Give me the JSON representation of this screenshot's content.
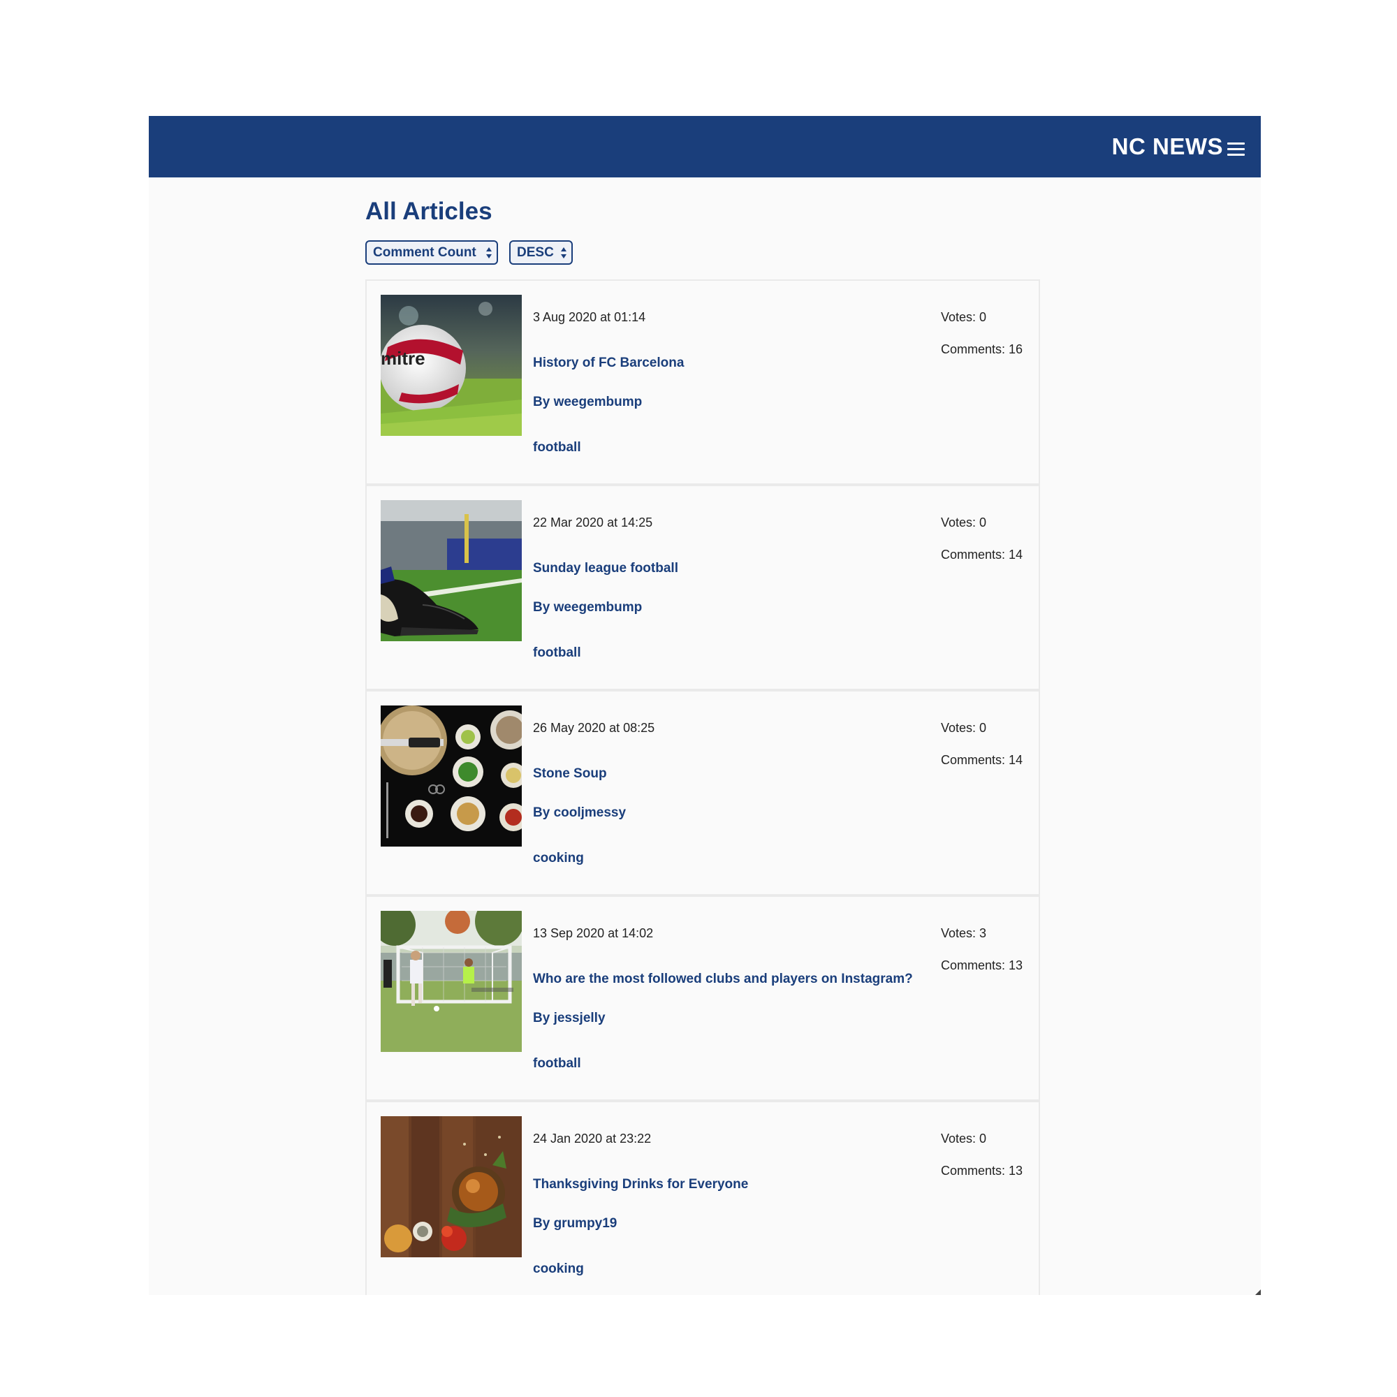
{
  "header": {
    "brand": "NC NEWS",
    "menu_icon": "hamburger-menu-icon"
  },
  "page": {
    "title": "All Articles"
  },
  "controls": {
    "sort_by": {
      "selected": "Comment Count"
    },
    "order": {
      "selected": "DESC"
    }
  },
  "colors": {
    "primary": "#1a3e7b",
    "background": "#fafafa",
    "card_border": "#eaeaea"
  },
  "articles": [
    {
      "date": "3 Aug 2020 at 01:14",
      "title": "History of FC Barcelona",
      "author": "By weegembump",
      "topic": "football",
      "votes": "Votes: 0",
      "comments": "Comments: 16",
      "image": "football-on-grass-photo"
    },
    {
      "date": "22 Mar 2020 at 14:25",
      "title": "Sunday league football",
      "author": "By weegembump",
      "topic": "football",
      "votes": "Votes: 0",
      "comments": "Comments: 14",
      "image": "football-boot-on-pitch-photo"
    },
    {
      "date": "26 May 2020 at 08:25",
      "title": "Stone Soup",
      "author": "By cooljmessy",
      "topic": "cooking",
      "votes": "Votes: 0",
      "comments": "Comments: 14",
      "image": "cooking-ingredients-bowls-photo"
    },
    {
      "date": "13 Sep 2020 at 14:02",
      "title": "Who are the most followed clubs and players on Instagram?",
      "author": "By jessjelly",
      "topic": "football",
      "votes": "Votes: 3",
      "comments": "Comments: 13",
      "image": "soccer-match-goal-photo"
    },
    {
      "date": "24 Jan 2020 at 23:22",
      "title": "Thanksgiving Drinks for Everyone",
      "author": "By grumpy19",
      "topic": "cooking",
      "votes": "Votes: 0",
      "comments": "Comments: 13",
      "image": "thanksgiving-table-food-photo"
    }
  ]
}
